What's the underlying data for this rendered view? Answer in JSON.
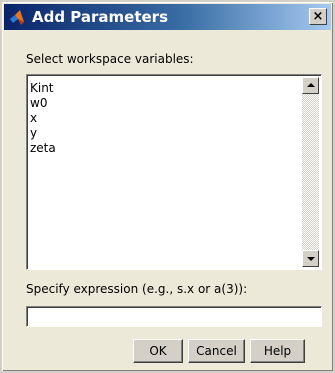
{
  "window": {
    "title": "Add Parameters",
    "close_label": "×"
  },
  "labels": {
    "select_vars": "Select workspace variables:",
    "specify_expr": "Specify expression (e.g., s.x or a(3)):"
  },
  "variables": [
    "Kint",
    "w0",
    "x",
    "y",
    "zeta"
  ],
  "expression": {
    "value": ""
  },
  "buttons": {
    "ok": "OK",
    "cancel": "Cancel",
    "help": "Help"
  }
}
